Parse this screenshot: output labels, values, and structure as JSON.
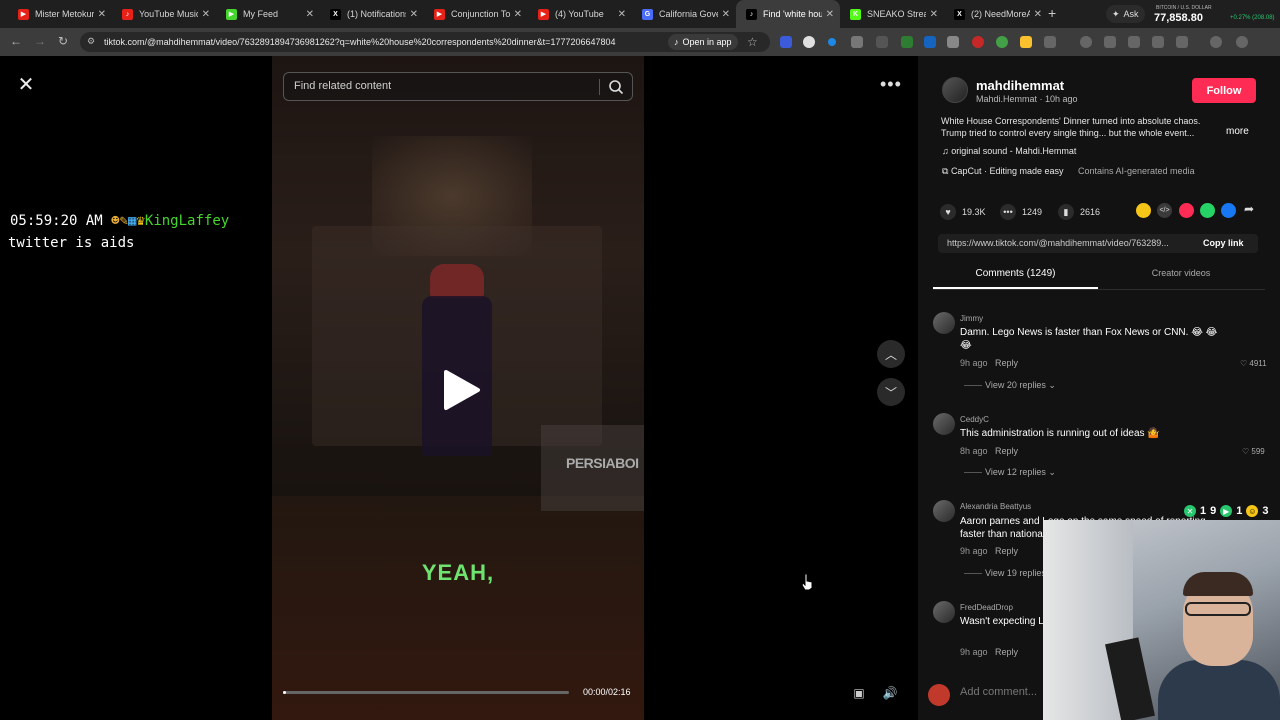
{
  "browser": {
    "tabs": [
      {
        "label": "Mister Metokur",
        "color": "#e62117",
        "glyph": "▶"
      },
      {
        "label": "YouTube Music",
        "color": "#e62117",
        "glyph": "♪"
      },
      {
        "label": "My Feed",
        "color": "#44d62c",
        "glyph": "▶"
      },
      {
        "label": "(1) Notifications",
        "color": "#000000",
        "glyph": "X"
      },
      {
        "label": "Conjunction Tor",
        "color": "#e62117",
        "glyph": "▶"
      },
      {
        "label": "(4) YouTube",
        "color": "#e62117",
        "glyph": "▶"
      },
      {
        "label": "California Gover",
        "color": "#4a6cf7",
        "glyph": "G"
      },
      {
        "label": "Find 'white hou",
        "color": "#000000",
        "glyph": "♪"
      },
      {
        "label": "SNEAKO Stream",
        "color": "#53fc18",
        "glyph": "K"
      },
      {
        "label": "(2) NeedMoreA",
        "color": "#000000",
        "glyph": "X"
      }
    ],
    "active_tab_index": 7,
    "ask_label": "Ask",
    "btc": {
      "name": "BITCOIN / U.S. DOLLAR",
      "symbol": "BTCUSD",
      "price": "77,858.80",
      "change": "+0.27% (208.08)"
    },
    "url": "tiktok.com/@mahdihemmat/video/7632891894736981262?q=white%20house%20correspondents%20dinner&t=1777206647804",
    "open_in_app": "Open in app"
  },
  "overlay": {
    "time": "05:59:20 AM",
    "user": "KingLaffey",
    "message": "twitter is aids"
  },
  "video": {
    "search_placeholder": "Find related content",
    "caption": "YEAH,",
    "watermark": "PERSIABOI",
    "time": "00:00/02:16",
    "progress": 0.01
  },
  "author": {
    "username": "mahdihemmat",
    "display_line": "Mahdi.Hemmat · 10h ago",
    "follow": "Follow",
    "description": "White House Correspondents' Dinner turned into absolute chaos. Trump tried to control every single thing... but the whole event...",
    "more": "more",
    "sound": "original sound - Mahdi.Hemmat",
    "capcut": "CapCut · Editing made easy",
    "ai_tag": "Contains AI-generated media"
  },
  "stats": {
    "likes": "19.3K",
    "comments": "1249",
    "saves": "2616"
  },
  "share": {
    "link": "https://www.tiktok.com/@mahdihemmat/video/763289...",
    "copy": "Copy link",
    "icons": [
      {
        "name": "tiktok-friends-icon",
        "color": "#f5c518"
      },
      {
        "name": "embed-icon",
        "color": "#3a3a3a"
      },
      {
        "name": "send-icon",
        "color": "#fe2c55"
      },
      {
        "name": "whatsapp-icon",
        "color": "#25d366"
      },
      {
        "name": "facebook-icon",
        "color": "#1877f2"
      }
    ]
  },
  "tabs": {
    "comments": "Comments (1249)",
    "creator": "Creator videos"
  },
  "comments": [
    {
      "user": "Jimmy",
      "text": "Damn. Lego News is faster than Fox News or CNN. 😂 😂 😂",
      "time": "9h ago",
      "reply": "Reply",
      "likes": "4911",
      "view": "View 20 replies"
    },
    {
      "user": "CeddyC",
      "text": "This administration is running out of ideas 🤷",
      "time": "8h ago",
      "reply": "Reply",
      "likes": "599",
      "view": "View 12 replies"
    },
    {
      "user": "Alexandria Beattyus",
      "text": "Aaron parnes and Lego on the same speed of reporting faster than national news",
      "time": "9h ago",
      "reply": "Reply",
      "likes": "",
      "view": "View 19 replies"
    },
    {
      "user": "FredDeadDrop",
      "text": "Wasn't expecting Lego to be the first to report breaking 😂",
      "time": "9h ago",
      "reply": "Reply",
      "likes": "",
      "view": ""
    }
  ],
  "add_comment": "Add comment...",
  "reactions": {
    "a": "1",
    "b": "9",
    "c": "1",
    "d": "3"
  }
}
